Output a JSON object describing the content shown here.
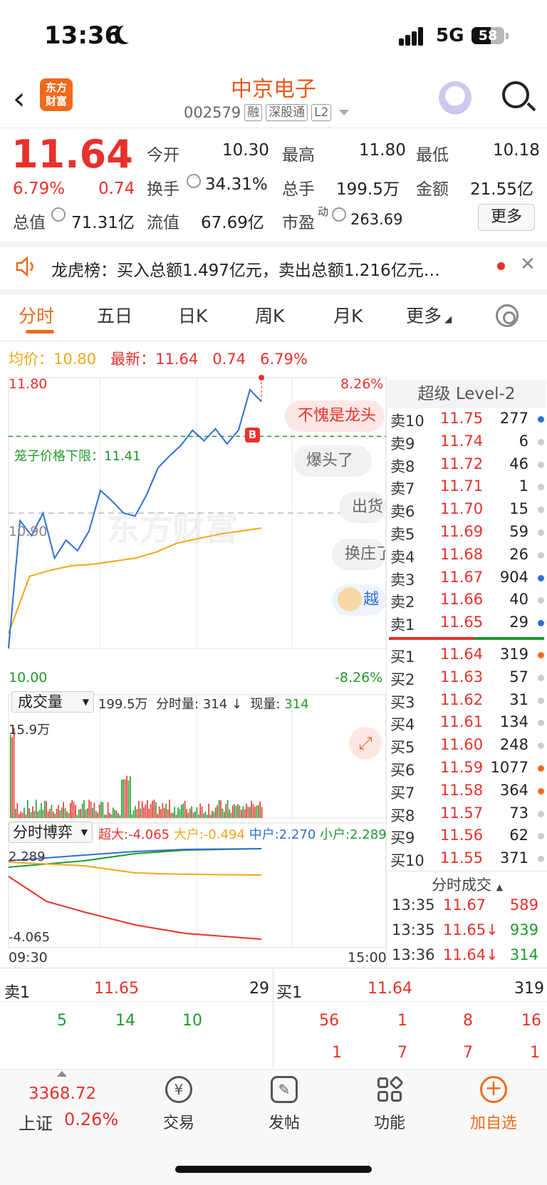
{
  "status_bar": {
    "time": "13:36",
    "network": "5G",
    "battery": "58"
  },
  "header": {
    "logo_text": "东方\n财富",
    "stock_name": "中京电子",
    "stock_code": "002579",
    "tags": [
      "融",
      "深股通",
      "L2"
    ]
  },
  "quote": {
    "price": "11.64",
    "change_pct": "6.79%",
    "change": "0.74",
    "fields": [
      {
        "label": "今开",
        "value": "10.30",
        "color": "green"
      },
      {
        "label": "最高",
        "value": "11.80",
        "color": "red"
      },
      {
        "label": "最低",
        "value": "10.18",
        "color": "green"
      },
      {
        "label": "换手",
        "value": "34.31%",
        "color": "black"
      },
      {
        "label": "总手",
        "value": "199.5万",
        "color": "black"
      },
      {
        "label": "金额",
        "value": "21.55亿",
        "color": "black"
      },
      {
        "label": "总值",
        "value": "71.31亿",
        "color": "black"
      },
      {
        "label": "流值",
        "value": "67.69亿",
        "color": "black"
      },
      {
        "label": "市盈",
        "value": "263.69",
        "color": "black"
      }
    ],
    "pe_superscript": "动",
    "more_label": "更多"
  },
  "notice": {
    "text": "龙虎榜：买入总额1.497亿元，卖出总额1.216亿元…"
  },
  "tabs": [
    "分时",
    "五日",
    "日K",
    "周K",
    "月K",
    "更多"
  ],
  "info_line": {
    "avg_label": "均价：",
    "avg_value": "10.80",
    "latest_label": "最新：",
    "latest_value": "11.64",
    "chg": "0.74",
    "pct": "6.79%"
  },
  "chart": {
    "y_top": "11.80",
    "y_mid": "10.90",
    "y_bottom": "10.00",
    "pct_top": "8.26%",
    "pct_bottom": "-8.26%",
    "limit_label": "笼子价格下限：11.41",
    "watermark": "东方财富",
    "marker": "B",
    "time_start": "09:30",
    "time_end": "15:00"
  },
  "comments": [
    "不愧是龙头",
    "爆头了",
    "出货",
    "换庄了",
    "越"
  ],
  "volume": {
    "selector": "成交量",
    "total": "199.5万",
    "fenshi_label": "分时量:",
    "fenshi_value": "314 ↓",
    "xian_label": "现量:",
    "xian_value": "314",
    "max_label": "15.9万"
  },
  "bo": {
    "selector": "分时博弈",
    "super_label": "超大:",
    "super_value": "-4.065",
    "big_label": "大户:",
    "big_value": "-0.494",
    "mid_label": "中户:",
    "mid_value": "2.270",
    "small_label": "小户:",
    "small_value": "2.289",
    "y_top": "2.289",
    "y_bottom": "-4.065"
  },
  "chart_data": {
    "type": "line",
    "title": "",
    "x": [
      "09:30",
      "15:00"
    ],
    "ylim": [
      10.0,
      11.8
    ],
    "series": [
      {
        "name": "最新",
        "values": [
          10.0,
          10.85,
          10.75,
          10.9,
          10.6,
          10.72,
          10.65,
          10.78,
          11.05,
          10.98,
          10.9,
          10.88,
          11.02,
          11.2,
          11.28,
          11.35,
          11.45,
          11.38,
          11.46,
          11.36,
          11.45,
          11.72,
          11.64
        ]
      },
      {
        "name": "均价",
        "values": [
          10.1,
          10.48,
          10.52,
          10.55,
          10.56,
          10.58,
          10.6,
          10.64,
          10.7,
          10.73,
          10.76,
          10.78,
          10.8
        ]
      }
    ]
  },
  "orderbook": {
    "title": "超级 Level-2",
    "asks": [
      {
        "label": "卖10",
        "price": "11.75",
        "vol": "277",
        "dot": "#2f6fd3"
      },
      {
        "label": "卖9",
        "price": "11.74",
        "vol": "6",
        "dot": "#cccccc"
      },
      {
        "label": "卖8",
        "price": "11.72",
        "vol": "46",
        "dot": "#cccccc"
      },
      {
        "label": "卖7",
        "price": "11.71",
        "vol": "1",
        "dot": "#cccccc"
      },
      {
        "label": "卖6",
        "price": "11.70",
        "vol": "15",
        "dot": "#cccccc"
      },
      {
        "label": "卖5",
        "price": "11.69",
        "vol": "59",
        "dot": "#cccccc"
      },
      {
        "label": "卖4",
        "price": "11.68",
        "vol": "26",
        "dot": "#cccccc"
      },
      {
        "label": "卖3",
        "price": "11.67",
        "vol": "904",
        "dot": "#2f6fd3"
      },
      {
        "label": "卖2",
        "price": "11.66",
        "vol": "40",
        "dot": "#cccccc"
      },
      {
        "label": "卖1",
        "price": "11.65",
        "vol": "29",
        "dot": "#2f6fd3"
      }
    ],
    "bids": [
      {
        "label": "买1",
        "price": "11.64",
        "vol": "319",
        "dot": "#f06a1d"
      },
      {
        "label": "买2",
        "price": "11.63",
        "vol": "57",
        "dot": "#cccccc"
      },
      {
        "label": "买3",
        "price": "11.62",
        "vol": "31",
        "dot": "#cccccc"
      },
      {
        "label": "买4",
        "price": "11.61",
        "vol": "134",
        "dot": "#cccccc"
      },
      {
        "label": "买5",
        "price": "11.60",
        "vol": "248",
        "dot": "#cccccc"
      },
      {
        "label": "买6",
        "price": "11.59",
        "vol": "1077",
        "dot": "#f06a1d"
      },
      {
        "label": "买7",
        "price": "11.58",
        "vol": "364",
        "dot": "#f06a1d"
      },
      {
        "label": "买8",
        "price": "11.57",
        "vol": "73",
        "dot": "#cccccc"
      },
      {
        "label": "买9",
        "price": "11.56",
        "vol": "62",
        "dot": "#cccccc"
      },
      {
        "label": "买10",
        "price": "11.55",
        "vol": "371",
        "dot": "#cccccc"
      }
    ],
    "trades_title": "分时成交",
    "trades": [
      {
        "time": "13:35",
        "price": "11.67",
        "arrow": "",
        "vol": "589",
        "vcolor": "#e8312b"
      },
      {
        "time": "13:35",
        "price": "11.65↓",
        "arrow": "",
        "vol": "939",
        "vcolor": "#1f9a2c"
      },
      {
        "time": "13:36",
        "price": "11.64↓",
        "arrow": "",
        "vol": "314",
        "vcolor": "#1f9a2c"
      }
    ]
  },
  "strip": {
    "sell_label": "卖1",
    "sell_price": "11.65",
    "sell_vol": "29",
    "buy_label": "买1",
    "buy_price": "11.64",
    "buy_vol": "319",
    "sell_orders": [
      "5",
      "14",
      "10"
    ],
    "buy_orders_row1": [
      "56",
      "1",
      "8",
      "16"
    ],
    "buy_orders_row2": [
      "1",
      "7",
      "7",
      "1"
    ]
  },
  "bottom_nav": {
    "index_value": "3368.72",
    "index_name": "上证",
    "index_pct": "0.26%",
    "items": [
      {
        "label": "交易",
        "icon": "yen-exchange-icon"
      },
      {
        "label": "发帖",
        "icon": "edit-icon"
      },
      {
        "label": "功能",
        "icon": "grid-icon"
      },
      {
        "label": "加自选",
        "icon": "plus-circle-icon"
      }
    ]
  },
  "colors": {
    "up": "#e8312b",
    "down": "#1f9a2c",
    "avg_line": "#f4a51c",
    "price_line": "#2f6fd3",
    "accent": "#f06a1d"
  }
}
